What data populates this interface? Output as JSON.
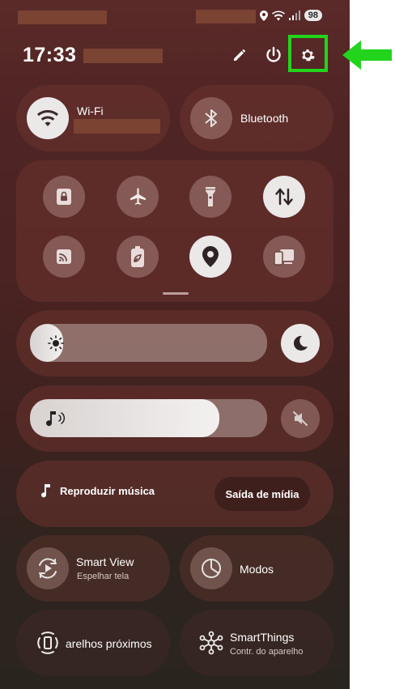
{
  "status_bar": {
    "battery": "98"
  },
  "header": {
    "time": "17:33"
  },
  "wifi": {
    "label": "Wi-Fi"
  },
  "bluetooth": {
    "label": "Bluetooth"
  },
  "media": {
    "play_label": "Reproduzir música",
    "output_label": "Saída de mídia"
  },
  "smart_view": {
    "title": "Smart View",
    "subtitle": "Espelhar tela"
  },
  "modos": {
    "title": "Modos"
  },
  "nearby": {
    "title": "arelhos próximos"
  },
  "smartthings": {
    "title": "SmartThings",
    "subtitle": "Contr. do aparelho"
  },
  "sliders": {
    "brightness_level": 0.14,
    "volume_level": 0.8
  },
  "colors": {
    "annotation_green": "#22d41c",
    "tile_on": "#ebe8e8"
  },
  "icons": [
    "wifi-icon",
    "bluetooth-icon",
    "lock-icon",
    "airplane-icon",
    "flashlight-icon",
    "data-sync-icon",
    "cast-icon",
    "battery-saver-icon",
    "location-icon",
    "device-icon",
    "sun-icon",
    "moon-icon",
    "music-icon",
    "mute-icon",
    "smart-view-icon",
    "modes-icon",
    "nearby-icon",
    "smartthings-icon",
    "pencil-icon",
    "power-icon",
    "gear-icon"
  ]
}
